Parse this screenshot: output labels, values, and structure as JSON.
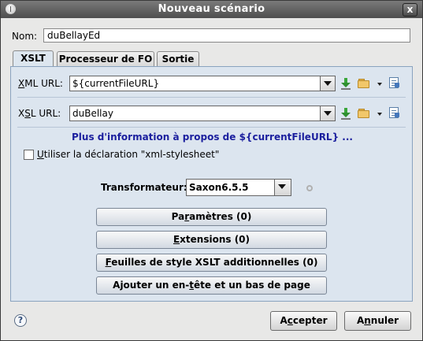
{
  "window": {
    "title": "Nouveau scénario",
    "close_label": "x"
  },
  "nom": {
    "label": "Nom:",
    "value": "duBellayEd"
  },
  "tabs": [
    {
      "label": "XSLT",
      "active": true
    },
    {
      "label": "Processeur de FO",
      "active": false
    },
    {
      "label": "Sortie",
      "active": false
    }
  ],
  "xml_url": {
    "label_mnemonic": "X",
    "label_rest": "ML URL:",
    "value": "${currentFileURL}"
  },
  "xsl_url": {
    "label_pre": "X",
    "label_mnemonic": "S",
    "label_rest": "L URL:",
    "value": "duBellay"
  },
  "info_link": "Plus d'information à propos de ${currentFileURL} ...",
  "stylesheet_pi": {
    "label_mnemonic": "U",
    "label_rest": "tiliser la déclaration \"xml-stylesheet\"",
    "checked": false
  },
  "transformer": {
    "label": "Transformateur:",
    "value": "Saxon6.5.5"
  },
  "buttons": {
    "params": {
      "pre": "Pa",
      "mn": "r",
      "post": "amètres (0)"
    },
    "extensions": {
      "pre": "",
      "mn": "E",
      "post": "xtensions (0)"
    },
    "additional_xslt": {
      "pre": "",
      "mn": "F",
      "post": "euilles de style XSLT additionnelles (0)"
    },
    "header_footer": {
      "pre": "Ajouter un en-",
      "mn": "t",
      "post": "ête et un bas de page"
    }
  },
  "footer": {
    "accept": {
      "pre": "A",
      "mn": "c",
      "post": "cepter"
    },
    "cancel": {
      "pre": "A",
      "mn": "n",
      "post": "nuler"
    }
  },
  "help_label": "?"
}
